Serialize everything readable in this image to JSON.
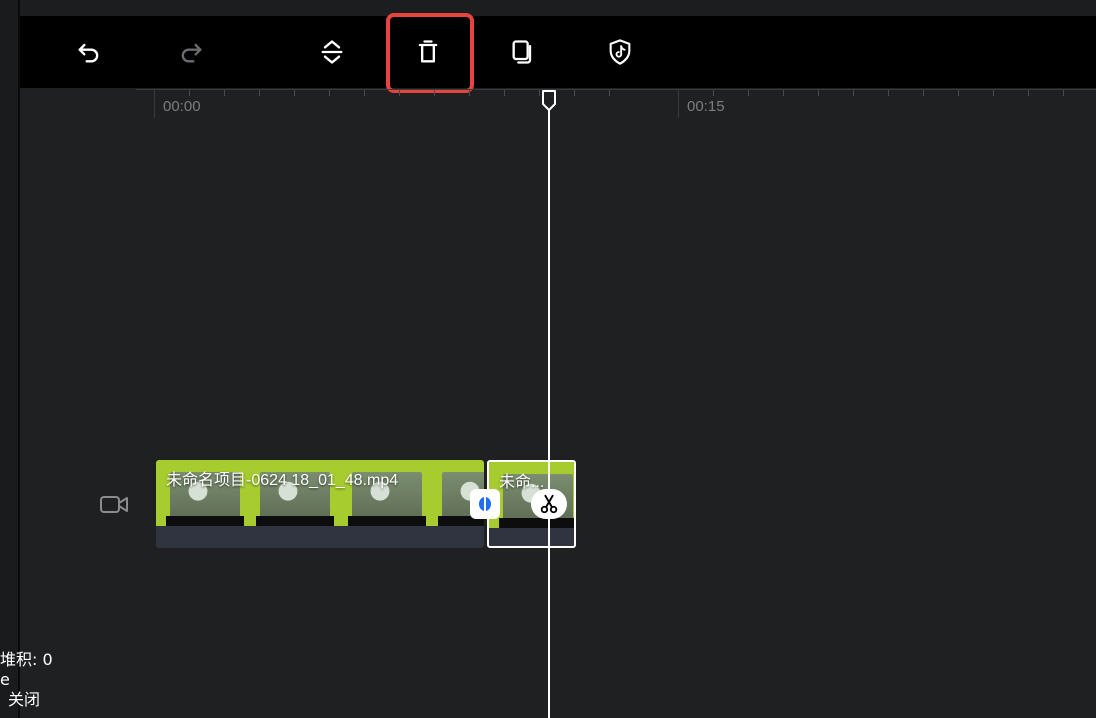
{
  "toolbar": {
    "undo_icon": "undo-icon",
    "redo_icon": "redo-icon",
    "expand_icon": "expand-collapse-icon",
    "delete_icon": "trash-icon",
    "copy_icon": "copy-icon",
    "tiktok_icon": "tiktok-shield-icon",
    "highlight_color": "#e8443f"
  },
  "ruler": {
    "labels": [
      "00:00",
      "00:15"
    ]
  },
  "track": {
    "icon": "video-camera-icon",
    "clips": [
      {
        "label": "未命名项目-0624 18_01_48.mp4"
      },
      {
        "label": "未命..."
      }
    ],
    "clip_color": "#a6cc2f"
  },
  "debug": {
    "line1": "堆积: 0",
    "line2": "e",
    "line3": "关闭"
  }
}
